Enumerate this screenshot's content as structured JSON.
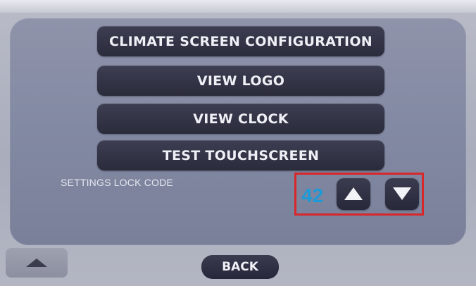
{
  "menu": {
    "items": [
      {
        "label": "CLIMATE SCREEN CONFIGURATION"
      },
      {
        "label": "VIEW LOGO"
      },
      {
        "label": "VIEW CLOCK"
      },
      {
        "label": "TEST TOUCHSCREEN"
      }
    ]
  },
  "lock_code": {
    "label": "SETTINGS LOCK CODE",
    "value": "42",
    "value_color": "#1d9ad7",
    "increment_icon": "triangle-up-icon",
    "decrement_icon": "triangle-down-icon",
    "highlight_color": "#d8262a"
  },
  "footer": {
    "scroll_up_icon": "triangle-up-icon",
    "back_label": "BACK"
  }
}
